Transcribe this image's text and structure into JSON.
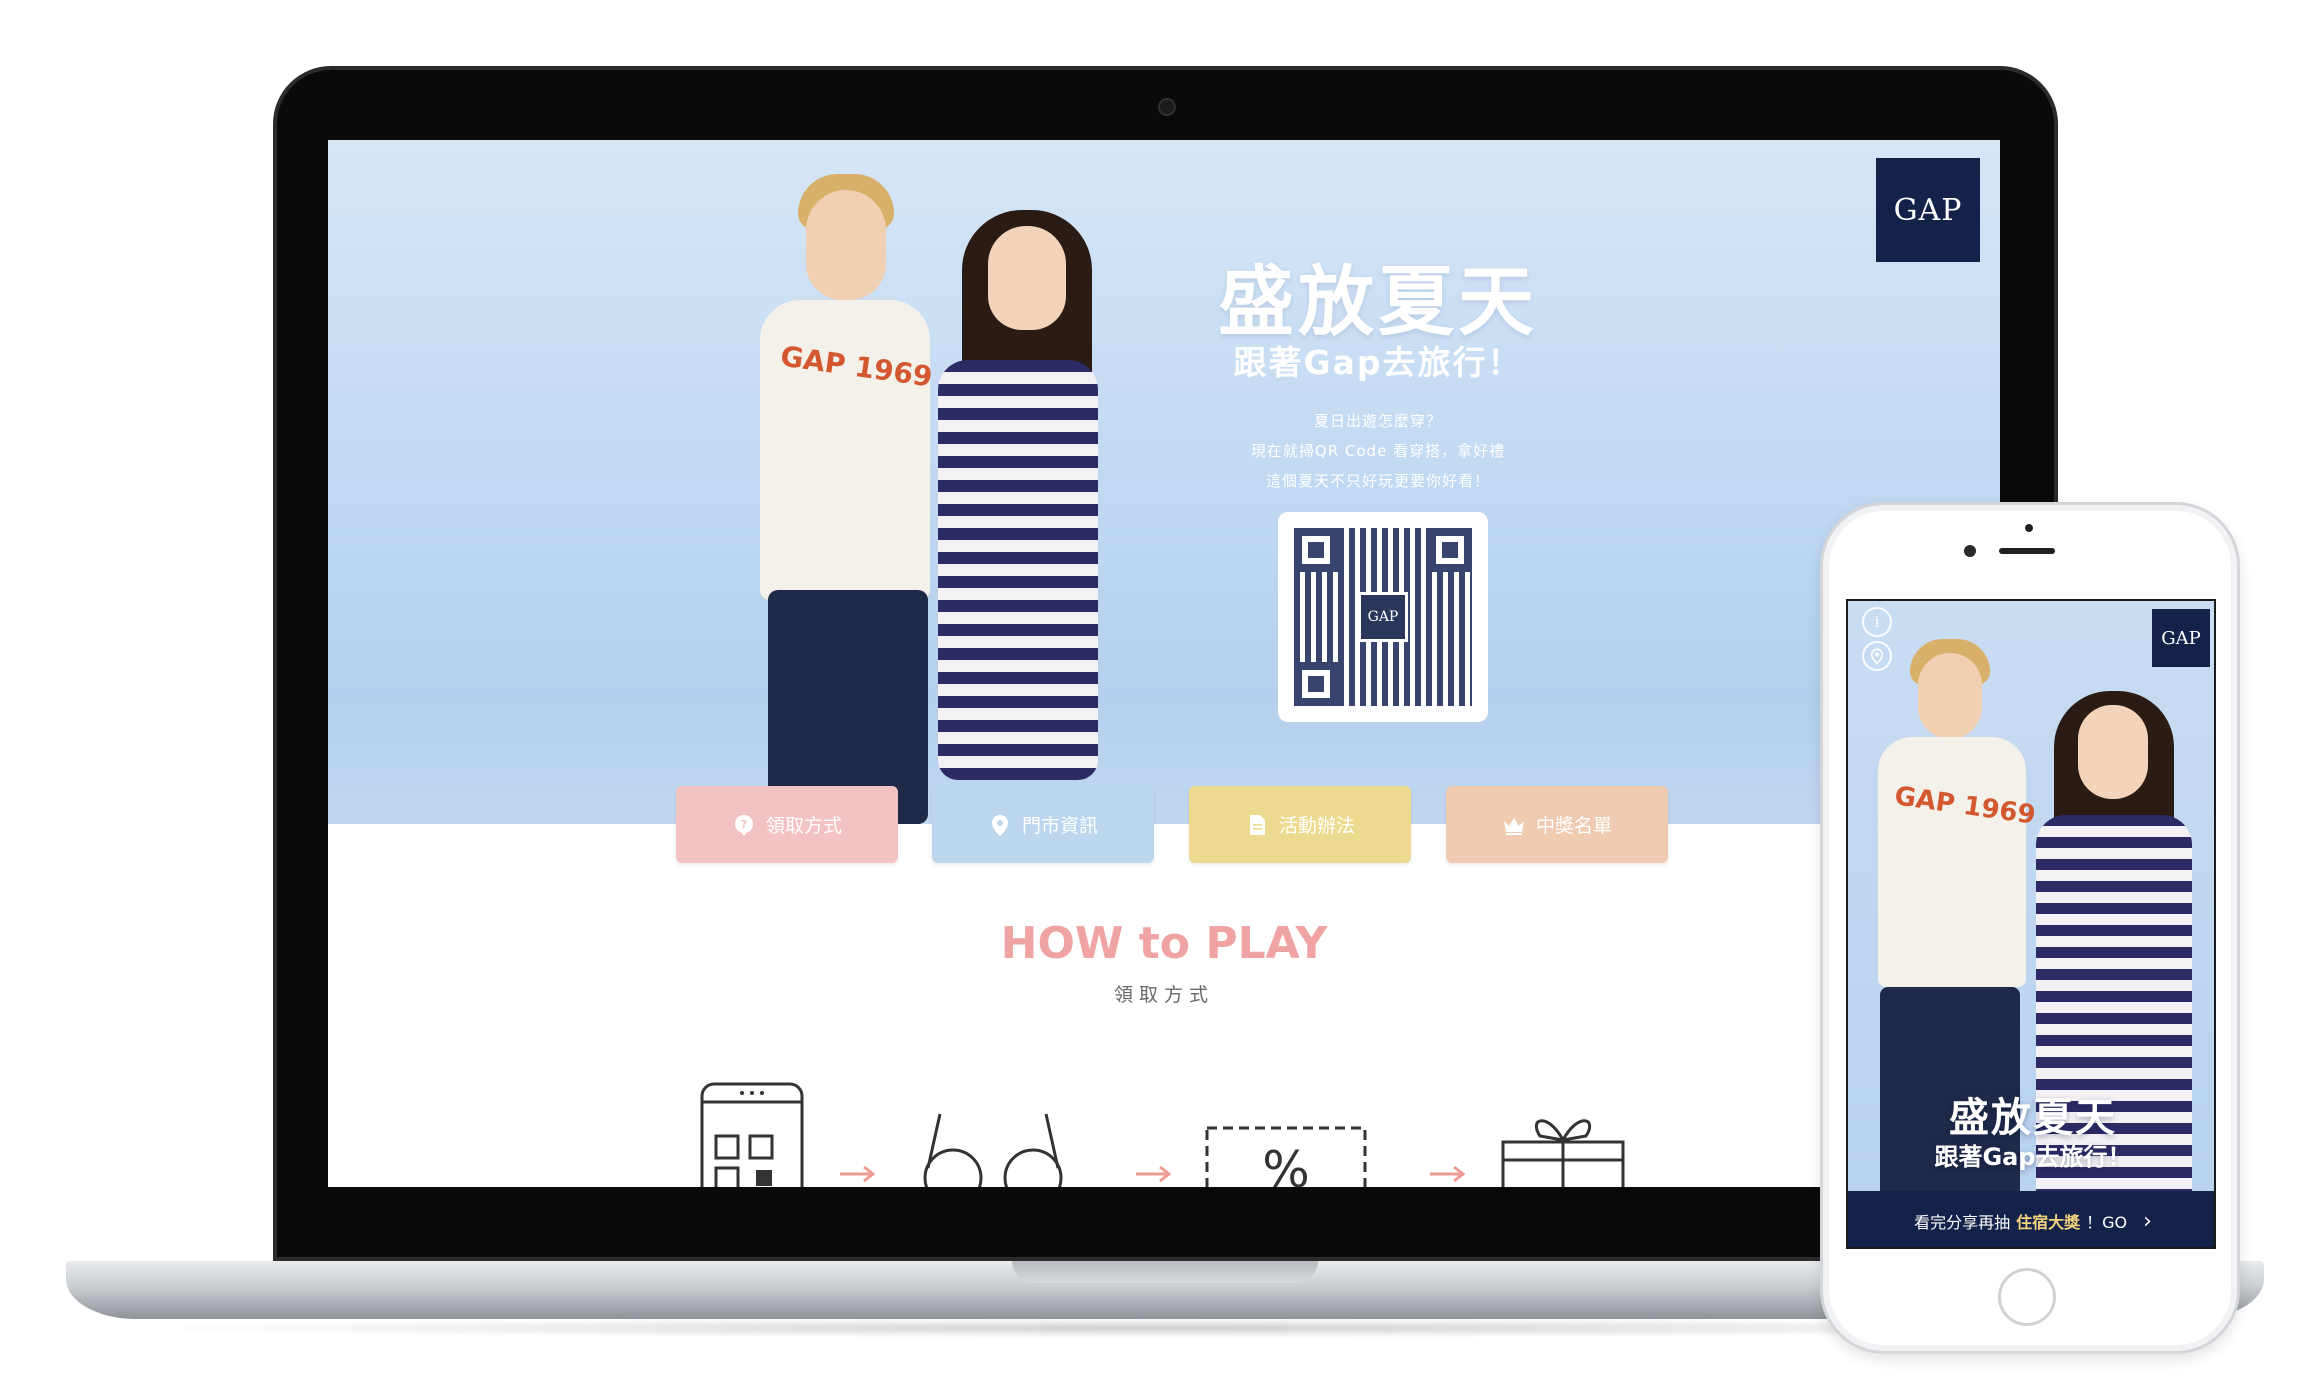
{
  "desktop": {
    "brand": "GAP",
    "hero": {
      "title": "盛放夏天",
      "subtitle": "跟著Gap去旅行！",
      "lines": [
        "夏日出遊怎麼穿？",
        "現在就掃QR Code 看穿搭，拿好禮",
        "這個夏天不只好玩更要你好看！"
      ],
      "shirt_print": "GAP 1969",
      "qr_logo": "GAP"
    },
    "nav": [
      {
        "label": "領取方式",
        "icon": "question-pin-icon",
        "color": "#f3c3c4"
      },
      {
        "label": "門市資訊",
        "icon": "location-pin-icon",
        "color": "#bcd6ee"
      },
      {
        "label": "活動辦法",
        "icon": "document-icon",
        "color": "#ecdb8e"
      },
      {
        "label": "中獎名單",
        "icon": "crown-icon",
        "color": "#efcbb2"
      }
    ],
    "howto": {
      "title": "HOW to PLAY",
      "subtitle": "領取方式"
    },
    "accent_arrow_color": "#f19a93"
  },
  "mobile": {
    "brand": "GAP",
    "info_icon": "i",
    "title": "盛放夏天",
    "subtitle": "跟著Gap去旅行！",
    "shirt_print": "GAP 1969",
    "cta": {
      "prefix": "看完分享再抽",
      "highlight": "住宿大獎",
      "suffix": "！GO",
      "arrow": "›"
    }
  }
}
